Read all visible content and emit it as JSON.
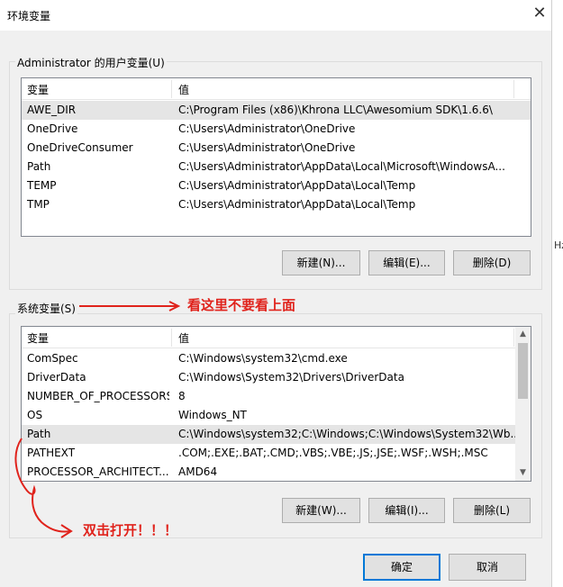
{
  "window": {
    "title": "环境变量",
    "close_icon": "close-icon"
  },
  "edge_text": "Hz",
  "user_group": {
    "label": "Administrator 的用户变量(U)",
    "columns": [
      "变量",
      "值"
    ],
    "rows": [
      {
        "name": "AWE_DIR",
        "value": "C:\\Program Files (x86)\\Khrona LLC\\Awesomium SDK\\1.6.6\\"
      },
      {
        "name": "OneDrive",
        "value": "C:\\Users\\Administrator\\OneDrive"
      },
      {
        "name": "OneDriveConsumer",
        "value": "C:\\Users\\Administrator\\OneDrive"
      },
      {
        "name": "Path",
        "value": "C:\\Users\\Administrator\\AppData\\Local\\Microsoft\\WindowsA..."
      },
      {
        "name": "TEMP",
        "value": "C:\\Users\\Administrator\\AppData\\Local\\Temp"
      },
      {
        "name": "TMP",
        "value": "C:\\Users\\Administrator\\AppData\\Local\\Temp"
      }
    ],
    "buttons": {
      "new": "新建(N)...",
      "edit": "编辑(E)...",
      "delete": "删除(D)"
    }
  },
  "system_group": {
    "label": "系统变量(S)",
    "columns": [
      "变量",
      "值"
    ],
    "rows": [
      {
        "name": "ComSpec",
        "value": "C:\\Windows\\system32\\cmd.exe"
      },
      {
        "name": "DriverData",
        "value": "C:\\Windows\\System32\\Drivers\\DriverData"
      },
      {
        "name": "NUMBER_OF_PROCESSORS",
        "value": "8"
      },
      {
        "name": "OS",
        "value": "Windows_NT"
      },
      {
        "name": "Path",
        "value": "C:\\Windows\\system32;C:\\Windows;C:\\Windows\\System32\\Wb..."
      },
      {
        "name": "PATHEXT",
        "value": ".COM;.EXE;.BAT;.CMD;.VBS;.VBE;.JS;.JSE;.WSF;.WSH;.MSC"
      },
      {
        "name": "PROCESSOR_ARCHITECT...",
        "value": "AMD64"
      }
    ],
    "buttons": {
      "new": "新建(W)...",
      "edit": "编辑(I)...",
      "delete": "删除(L)"
    }
  },
  "dialog_buttons": {
    "ok": "确定",
    "cancel": "取消"
  },
  "annotations": {
    "look_here": "看这里不要看上面",
    "double_click": "双击打开！！！"
  },
  "colors": {
    "annotation_red": "#e0231c",
    "accent_blue": "#0078d7"
  }
}
